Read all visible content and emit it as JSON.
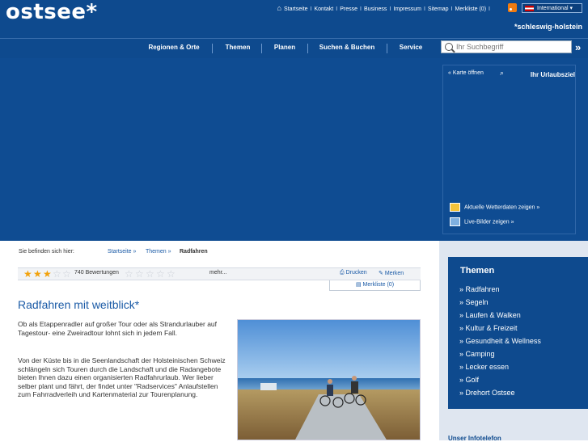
{
  "brand": {
    "logo": "ostsee*",
    "tagline": "*schleswig-holstein"
  },
  "toplinks": [
    "Startseite",
    "Kontakt",
    "Presse",
    "Business",
    "Impressum",
    "Sitemap",
    "Merkliste (0)"
  ],
  "language": "International",
  "nav": [
    "Regionen & Orte",
    "Themen",
    "Planen",
    "Suchen & Buchen",
    "Service"
  ],
  "search": {
    "placeholder": "Ihr Suchbegriff",
    "go": "»"
  },
  "mappanel": {
    "open": "Karte öffnen",
    "title": "Ihr Urlaubsziel",
    "weather": "Aktuelle Wetterdaten zeigen »",
    "live": "Live-Bilder zeigen »"
  },
  "breadcrumb": {
    "label": "Sie befinden sich hier:",
    "items": [
      "Startseite »",
      "Themen »",
      "Radfahren"
    ]
  },
  "rating": {
    "stars": 3,
    "max": 5,
    "count": "740 Bewertungen",
    "more": "mehr...",
    "print": "Drucken",
    "remember": "Merken",
    "list": "Merkliste (0)"
  },
  "article": {
    "title": "Radfahren mit weitblick*",
    "p1": "Ob als Etappenradler auf großer Tour oder als Strandurlauber auf Tagestour- eine Zweiradtour lohnt sich in jedem Fall.",
    "p2": "Von der Küste bis in die Seenlandschaft der Holsteinischen Schweiz schlängeln sich Touren durch die Landschaft und die Radangebote bieten Ihnen dazu einen organisierten Radfahrurlaub. Wer lieber selber plant und fährt, der findet unter \"Radservices\" Anlaufstellen zum Fahrradverleih und Kartenmaterial zur Tourenplanung."
  },
  "themen": {
    "title": "Themen",
    "items": [
      "» Radfahren",
      "» Segeln",
      "» Laufen & Walken",
      "» Kultur & Freizeit",
      "» Gesundheit & Wellness",
      "» Camping",
      "» Lecker essen",
      "» Golf",
      "» Drehort Ostsee"
    ]
  },
  "infotelefon": "Unser Infotelefon",
  "colors": {
    "brand": "#0e4a8e",
    "link": "#1a5aa6",
    "star": "#f2a20c"
  }
}
